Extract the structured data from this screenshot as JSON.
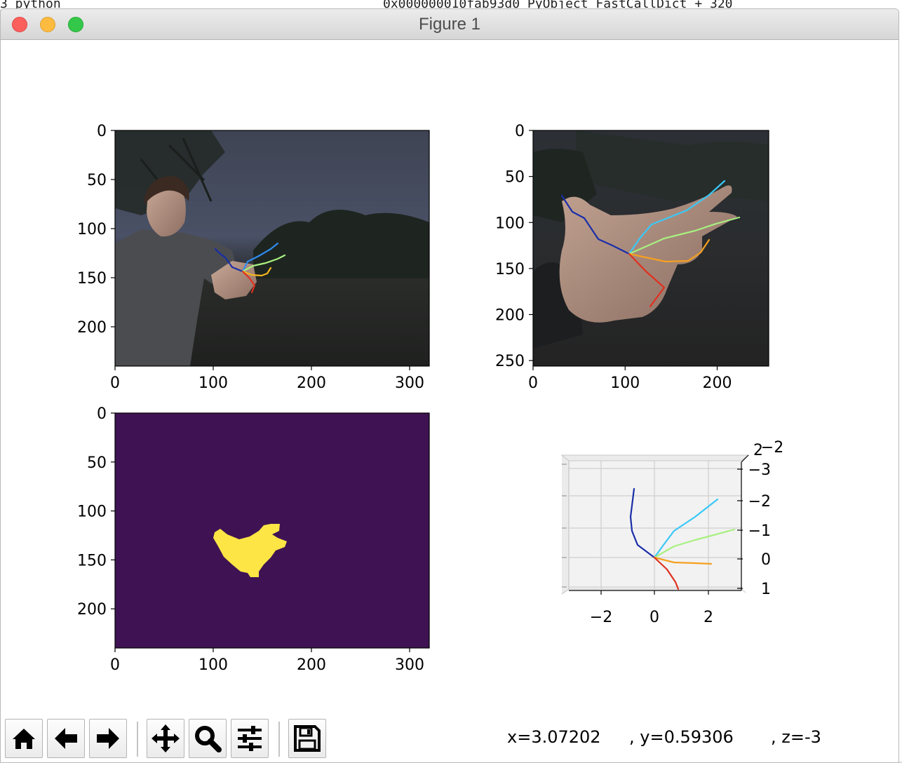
{
  "background_terminal": {
    "left_text": "3  python",
    "right_text": "0x000000010fab93d0  PyObject_FastCallDict + 320"
  },
  "window": {
    "title": "Figure 1"
  },
  "figure": {
    "subplots": [
      {
        "id": "image-top-left",
        "type": "image",
        "content": "photo of a person in a dark outdoor scene with a 2D hand skeleton overlay",
        "x_ticks": [
          0,
          100,
          200,
          300
        ],
        "y_ticks": [
          0,
          50,
          100,
          150,
          200
        ],
        "x_range": [
          0,
          320
        ],
        "y_range": [
          0,
          240
        ]
      },
      {
        "id": "image-top-right",
        "type": "image",
        "content": "cropped hand with 2D hand skeleton overlay",
        "x_ticks": [
          0,
          100,
          200
        ],
        "y_ticks": [
          0,
          50,
          100,
          150,
          200,
          250
        ],
        "x_range": [
          0,
          256
        ],
        "y_range": [
          0,
          256
        ]
      },
      {
        "id": "mask-bottom-left",
        "type": "image",
        "content": "binary hand segmentation mask, yellow hand on dark purple",
        "x_ticks": [
          0,
          100,
          200,
          300
        ],
        "y_ticks": [
          0,
          50,
          100,
          150,
          200
        ],
        "x_range": [
          0,
          320
        ],
        "y_range": [
          0,
          240
        ]
      },
      {
        "id": "plot3d-bottom-right",
        "type": "3d-line",
        "x_ticks": [
          "−2",
          "0",
          "2"
        ],
        "z_ticks": [
          "−3",
          "−2",
          "−1",
          "0",
          "1"
        ],
        "y_ticks": [
          "2",
          "−2"
        ]
      }
    ],
    "chart_data": [
      {
        "type": "image",
        "title": "",
        "x_ticks": [
          0,
          100,
          200,
          300
        ],
        "y_ticks": [
          0,
          50,
          100,
          150,
          200
        ],
        "xlim": [
          0,
          320
        ],
        "ylim": [
          240,
          0
        ]
      },
      {
        "type": "image",
        "title": "",
        "x_ticks": [
          0,
          100,
          200
        ],
        "y_ticks": [
          0,
          50,
          100,
          150,
          200,
          250
        ],
        "xlim": [
          0,
          256
        ],
        "ylim": [
          256,
          0
        ]
      },
      {
        "type": "heatmap",
        "title": "",
        "x_ticks": [
          0,
          100,
          200,
          300
        ],
        "y_ticks": [
          0,
          50,
          100,
          150,
          200
        ],
        "xlim": [
          0,
          320
        ],
        "ylim": [
          240,
          0
        ],
        "colors": {
          "background": "#3f1353",
          "foreground": "#fce545"
        }
      },
      {
        "type": "line",
        "title": "",
        "projection": "3d",
        "x_ticks": [
          -2,
          0,
          2
        ],
        "z_ticks": [
          -3,
          -2,
          -1,
          0,
          1
        ]
      }
    ]
  },
  "toolbar": {
    "buttons": [
      {
        "name": "home-button",
        "icon": "home-icon"
      },
      {
        "name": "back-button",
        "icon": "arrow-left-icon"
      },
      {
        "name": "forward-button",
        "icon": "arrow-right-icon"
      },
      {
        "name": "pan-button",
        "icon": "move-icon"
      },
      {
        "name": "zoom-button",
        "icon": "magnifier-icon"
      },
      {
        "name": "configure-subplots-button",
        "icon": "sliders-icon"
      },
      {
        "name": "save-button",
        "icon": "floppy-disk-icon"
      }
    ],
    "coordinates": {
      "x": "x=3.07202",
      "y": ", y=0.59306",
      "z": ", z=-3"
    }
  },
  "colors": {
    "mask_background": "#3f1353",
    "mask_foreground": "#fce545",
    "axes_3d_pane": "#f2f2f2"
  }
}
